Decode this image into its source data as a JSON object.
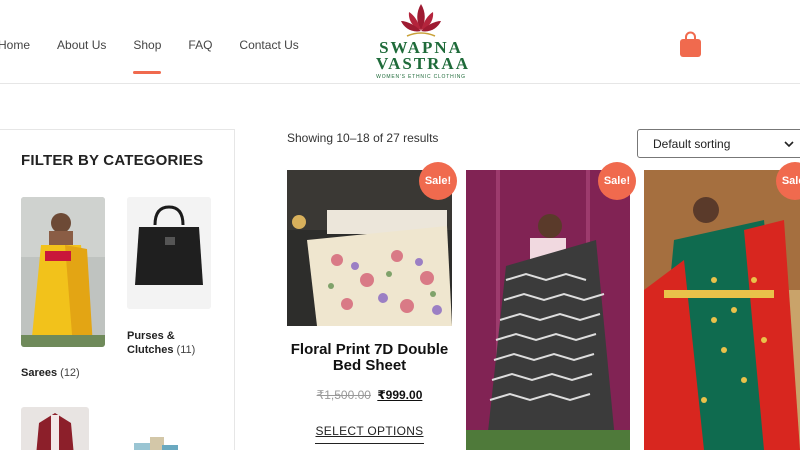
{
  "nav": {
    "items": [
      {
        "label": "Home"
      },
      {
        "label": "About Us"
      },
      {
        "label": "Shop"
      },
      {
        "label": "FAQ"
      },
      {
        "label": "Contact Us"
      }
    ],
    "active": "Shop"
  },
  "logo": {
    "line1": "SWAPNA",
    "line2": "VASTRAA",
    "tagline": "WOMEN'S ETHNIC CLOTHING"
  },
  "colors": {
    "accent": "#f06a4e",
    "brand_green": "#1f6b3a",
    "logo_red": "#9e1b32"
  },
  "sidebar": {
    "title": "FILTER BY CATEGORIES",
    "categories": [
      {
        "name": "Sarees",
        "count": "(12)"
      },
      {
        "name": "Purses & Clutches",
        "count": "(11)"
      }
    ]
  },
  "shop": {
    "result_count": "Showing 10–18 of 27 results",
    "sorting": "Default sorting"
  },
  "products": [
    {
      "badge": "Sale!",
      "title": "Floral Print 7D Double Bed Sheet",
      "old_price": "₹1,500.00",
      "new_price": "₹999.00",
      "button": "SELECT OPTIONS"
    },
    {
      "badge": "Sale!"
    },
    {
      "badge": "Sale!"
    }
  ]
}
